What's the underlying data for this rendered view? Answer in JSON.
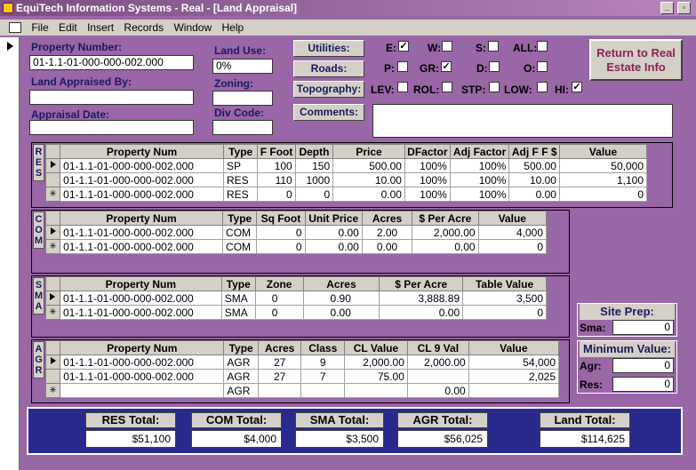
{
  "window": {
    "title": "EquiTech Information Systems - Real - [Land Appraisal]",
    "min": "_",
    "restore": "▫"
  },
  "menu": {
    "items": [
      "File",
      "Edit",
      "Insert",
      "Records",
      "Window",
      "Help"
    ]
  },
  "form": {
    "property_number_label": "Property Number:",
    "property_number": "01-1.1-01-000-000-002.000",
    "land_appraised_by_label": "Land Appraised By:",
    "land_appraised_by": "",
    "appraisal_date_label": "Appraisal Date:",
    "appraisal_date": "",
    "land_use_label": "Land Use:",
    "land_use": "0%",
    "zoning_label": "Zoning:",
    "zoning": "",
    "div_code_label": "Div Code:",
    "div_code": "",
    "utilities_label": "Utilities:",
    "roads_label": "Roads:",
    "topography_label": "Topography:",
    "comments_label": "Comments:",
    "comments": "",
    "utilities": {
      "e": "E:",
      "w": "W:",
      "s": "S:",
      "all": "ALL:"
    },
    "roads": {
      "p": "P:",
      "gr": "GR:",
      "d": "D:",
      "o": "O:"
    },
    "topo": {
      "lev": "LEV:",
      "rol": "ROL:",
      "stp": "STP:",
      "low": "LOW:",
      "hi": "HI:"
    },
    "check": "✓",
    "return_button": "Return to Real Estate Info"
  },
  "res": {
    "tag": "RES",
    "headers": [
      "Property Num",
      "Type",
      "F Foot",
      "Depth",
      "Price",
      "DFactor",
      "Adj Factor",
      "Adj F F $",
      "Value"
    ],
    "rows": [
      [
        "01-1.1-01-000-000-002.000",
        "SP",
        "100",
        "150",
        "500.00",
        "100%",
        "100%",
        "500.00",
        "50,000"
      ],
      [
        "01-1.1-01-000-000-002.000",
        "RES",
        "110",
        "1000",
        "10.00",
        "100%",
        "100%",
        "10.00",
        "1,100"
      ],
      [
        "01-1.1-01-000-000-002.000",
        "RES",
        "0",
        "0",
        "0.00",
        "100%",
        "100%",
        "0.00",
        "0"
      ]
    ]
  },
  "com": {
    "tag": "COM",
    "headers": [
      "Property Num",
      "Type",
      "Sq Foot",
      "Unit Price",
      "Acres",
      "$ Per Acre",
      "Value"
    ],
    "rows": [
      [
        "01-1.1-01-000-000-002.000",
        "COM",
        "0",
        "0.00",
        "2.00",
        "2,000.00",
        "4,000"
      ],
      [
        "01-1.1-01-000-000-002.000",
        "COM",
        "0",
        "0.00",
        "0.00",
        "0.00",
        "0"
      ]
    ]
  },
  "sma": {
    "tag": "SMA",
    "headers": [
      "Property Num",
      "Type",
      "Zone",
      "Acres",
      "$ Per Acre",
      "Table Value"
    ],
    "rows": [
      [
        "01-1.1-01-000-000-002.000",
        "SMA",
        "0",
        "0.90",
        "3,888.89",
        "3,500"
      ],
      [
        "01-1.1-01-000-000-002.000",
        "SMA",
        "0",
        "0.00",
        "0.00",
        "0"
      ]
    ]
  },
  "agr": {
    "tag": "AGR",
    "headers": [
      "Property Num",
      "Type",
      "Acres",
      "Class",
      "CL Value",
      "CL 9 Val",
      "Value"
    ],
    "rows": [
      [
        "01-1.1-01-000-000-002.000",
        "AGR",
        "27",
        "9",
        "2,000.00",
        "2,000.00",
        "54,000"
      ],
      [
        "01-1.1-01-000-000-002.000",
        "AGR",
        "27",
        "7",
        "75.00",
        "",
        "2,025"
      ],
      [
        "",
        "AGR",
        "",
        "",
        "",
        "0.00",
        ""
      ]
    ]
  },
  "site_prep": {
    "title": "Site Prep:",
    "sma_label": "Sma:",
    "sma": "0"
  },
  "minimum": {
    "title": "Minimum Value:",
    "agr_label": "Agr:",
    "agr": "0",
    "res_label": "Res:",
    "res": "0"
  },
  "totals": {
    "res_label": "RES Total:",
    "res": "$51,100",
    "com_label": "COM Total:",
    "com": "$4,000",
    "sma_label": "SMA Total:",
    "sma": "$3,500",
    "agr_label": "AGR Total:",
    "agr": "$56,025",
    "land_label": "Land Total:",
    "land": "$114,625"
  }
}
